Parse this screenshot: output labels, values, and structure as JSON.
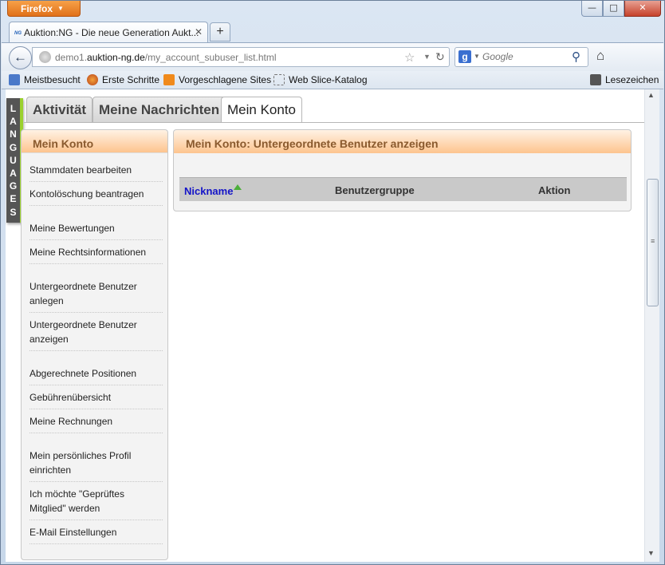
{
  "browser": {
    "menu_button": "Firefox",
    "tab_title": "Auktion:NG - Die neue Generation Aukt...",
    "tab_favicon": "NG",
    "url_prefix": "demo1.",
    "url_domain": "auktion-ng.de",
    "url_path": "/my_account_subuser_list.html",
    "search_placeholder": "Google",
    "bookmarks": [
      "Meistbesucht",
      "Erste Schritte",
      "Vorgeschlagene Sites",
      "Web Slice-Katalog"
    ],
    "bookmarks_right": "Lesezeichen"
  },
  "site": {
    "languages_tab": [
      "L",
      "A",
      "N",
      "G",
      "U",
      "A",
      "G",
      "E",
      "S"
    ],
    "tabs": [
      "Aktivität",
      "Meine Nachrichten",
      "Mein Konto"
    ],
    "active_tab": "Mein Konto"
  },
  "sidebar": {
    "title": "Mein Konto",
    "items": [
      "Stammdaten bearbeiten",
      "Kontolöschung beantragen",
      "Meine Bewertungen",
      "Meine Rechtsinformationen",
      "Untergeordnete Benutzer anlegen",
      "Untergeordnete Benutzer anzeigen",
      "Abgerechnete Positionen",
      "Gebührenübersicht",
      "Meine Rechnungen",
      "Mein persönliches Profil einrichten",
      "Ich möchte \"Geprüftes Mitglied\" werden",
      "E-Mail Einstellungen"
    ]
  },
  "main": {
    "title": "Mein Konto: Untergeordnete Benutzer anzeigen",
    "columns": [
      "Nickname",
      "Benutzergruppe",
      "Aktion"
    ],
    "sorted_column": "Nickname",
    "rows": []
  }
}
